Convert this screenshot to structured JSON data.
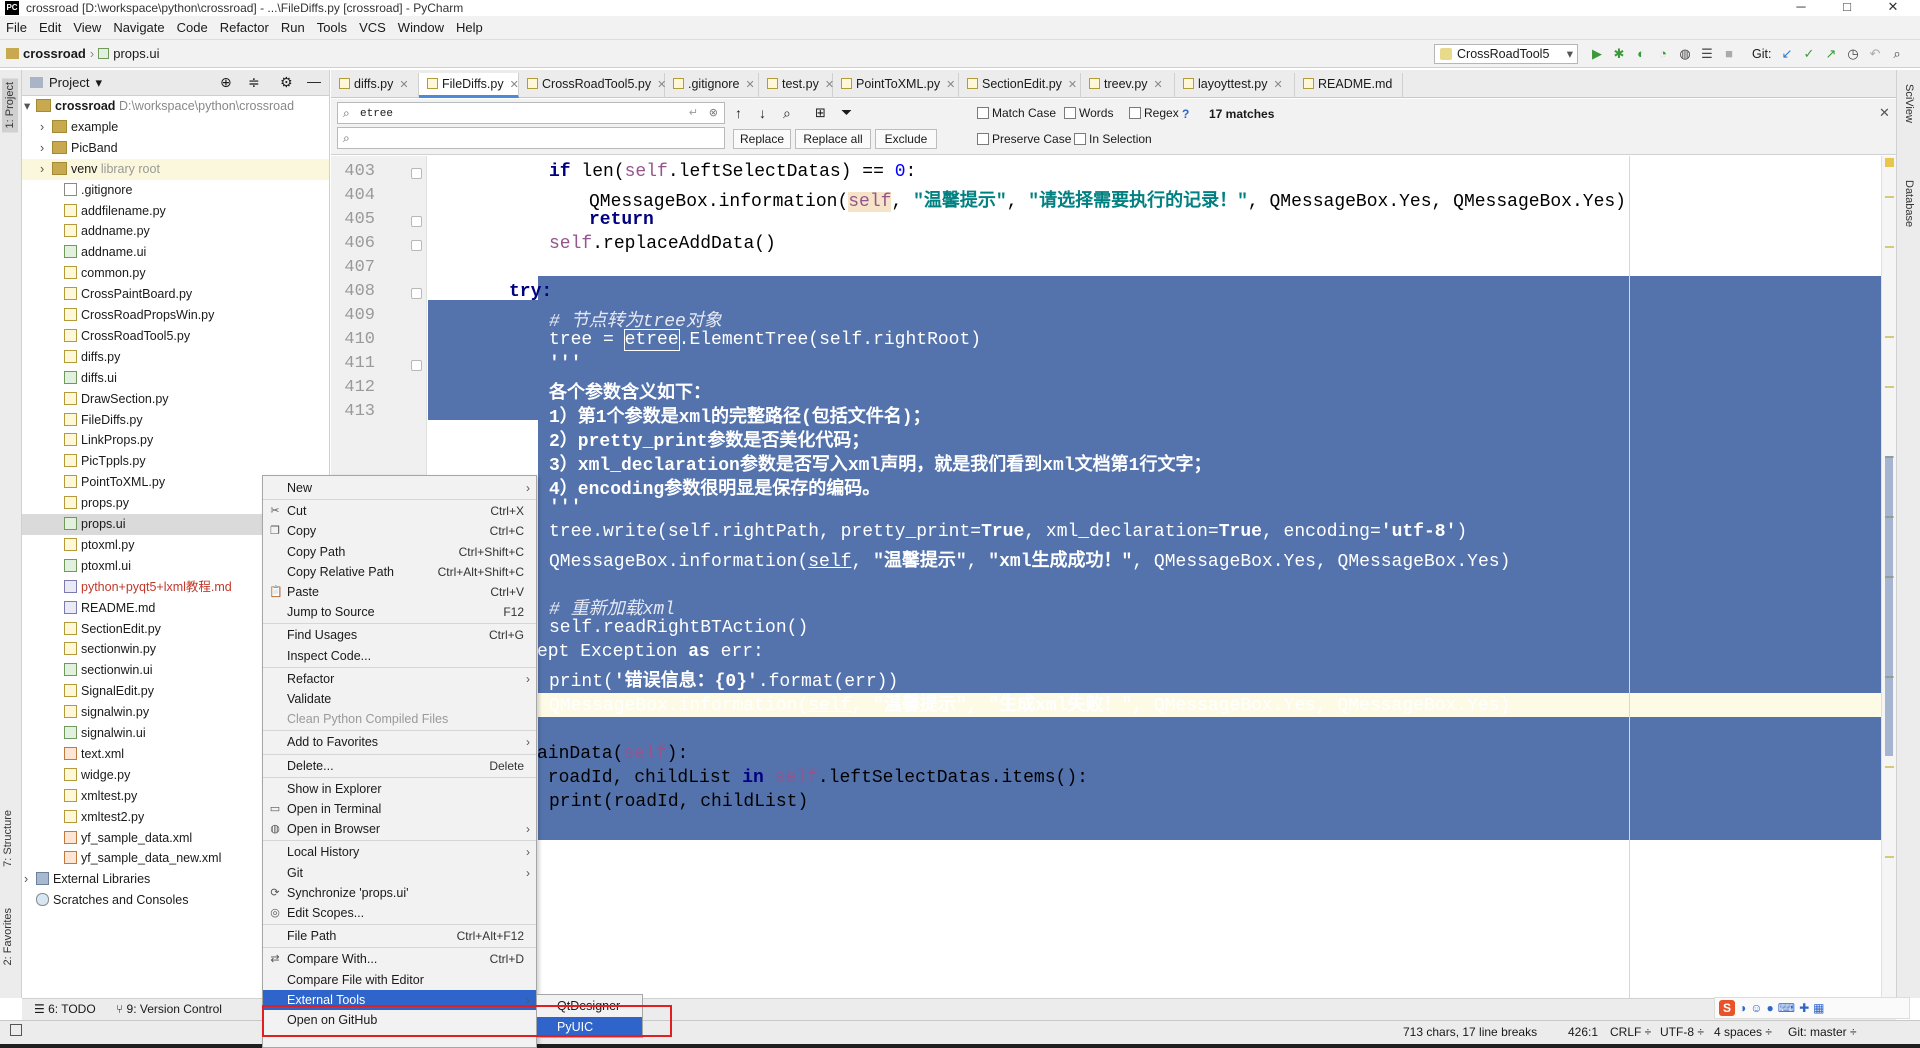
{
  "window": {
    "title": "crossroad [D:\\workspace\\python\\crossroad] - ...\\FileDiffs.py [crossroad] - PyCharm",
    "app_icon": "pycharm-icon",
    "minimize": "─",
    "maximize": "□",
    "close": "✕"
  },
  "menubar": [
    "File",
    "Edit",
    "View",
    "Navigate",
    "Code",
    "Refactor",
    "Run",
    "Tools",
    "VCS",
    "Window",
    "Help"
  ],
  "navbar": {
    "project": "crossroad",
    "file": "props.ui",
    "run_config": "CrossRoadTool5",
    "git_label": "Git:"
  },
  "project_panel": {
    "title": "Project",
    "root_name": "crossroad",
    "root_path": "D:\\workspace\\python\\crossroad",
    "items": [
      {
        "name": "example",
        "kind": "folder"
      },
      {
        "name": "PicBand",
        "kind": "folder"
      },
      {
        "name": "venv",
        "kind": "folder",
        "note": "library root"
      },
      {
        "name": ".gitignore",
        "kind": "file"
      },
      {
        "name": "addfilename.py",
        "kind": "py"
      },
      {
        "name": "addname.py",
        "kind": "py"
      },
      {
        "name": "addname.ui",
        "kind": "ui"
      },
      {
        "name": "common.py",
        "kind": "py"
      },
      {
        "name": "CrossPaintBoard.py",
        "kind": "py"
      },
      {
        "name": "CrossRoadPropsWin.py",
        "kind": "py"
      },
      {
        "name": "CrossRoadTool5.py",
        "kind": "py"
      },
      {
        "name": "diffs.py",
        "kind": "py"
      },
      {
        "name": "diffs.ui",
        "kind": "ui"
      },
      {
        "name": "DrawSection.py",
        "kind": "py"
      },
      {
        "name": "FileDiffs.py",
        "kind": "py"
      },
      {
        "name": "LinkProps.py",
        "kind": "py"
      },
      {
        "name": "PicTppls.py",
        "kind": "py"
      },
      {
        "name": "PointToXML.py",
        "kind": "py"
      },
      {
        "name": "props.py",
        "kind": "py"
      },
      {
        "name": "props.ui",
        "kind": "ui"
      },
      {
        "name": "ptoxml.py",
        "kind": "py"
      },
      {
        "name": "ptoxml.ui",
        "kind": "ui"
      },
      {
        "name": "python+pyqt5+lxml教程.md",
        "kind": "md"
      },
      {
        "name": "README.md",
        "kind": "md"
      },
      {
        "name": "SectionEdit.py",
        "kind": "py"
      },
      {
        "name": "sectionwin.py",
        "kind": "py"
      },
      {
        "name": "sectionwin.ui",
        "kind": "ui"
      },
      {
        "name": "SignalEdit.py",
        "kind": "py"
      },
      {
        "name": "signalwin.py",
        "kind": "py"
      },
      {
        "name": "signalwin.ui",
        "kind": "ui"
      },
      {
        "name": "text.xml",
        "kind": "xml"
      },
      {
        "name": "widge.py",
        "kind": "py"
      },
      {
        "name": "xmltest.py",
        "kind": "py"
      },
      {
        "name": "xmltest2.py",
        "kind": "py"
      },
      {
        "name": "yf_sample_data.xml",
        "kind": "xml"
      },
      {
        "name": "yf_sample_data_new.xml",
        "kind": "xml"
      }
    ],
    "external_libraries": "External Libraries",
    "scratches": "Scratches and Consoles"
  },
  "tabs": [
    "diffs.py",
    "FileDiffs.py",
    "CrossRoadTool5.py",
    ".gitignore",
    "test.py",
    "PointToXML.py",
    "SectionEdit.py",
    "treev.py",
    "layoyttest.py",
    "README.md"
  ],
  "findbar": {
    "query": "etree",
    "replace_btn": "Replace",
    "replace_all_btn": "Replace all",
    "exclude_btn": "Exclude",
    "match_case": "Match Case",
    "words": "Words",
    "regex": "Regex",
    "regex_help": "?",
    "matches": "17 matches",
    "preserve_case": "Preserve Case",
    "in_selection": "In Selection"
  },
  "editor": {
    "line_numbers": [
      "403",
      "404",
      "405",
      "406",
      "407",
      "408",
      "409",
      "410",
      "411",
      "412",
      "413"
    ],
    "code": {
      "l403_a": "if ",
      "l403_b": "len",
      "l403_c": "(",
      "l403_d": "self",
      "l403_e": ".leftSelectDatas) == ",
      "l403_f": "0",
      "l403_g": ":",
      "l404_a": "QMessageBox.information(",
      "l404_b": "self",
      "l404_c": ", ",
      "l404_d": "\"温馨提示\"",
      "l404_e": ", ",
      "l404_f": "\"请选择需要执行的记录！\"",
      "l404_g": ", QMessageBox.Yes, QMessageBox.Yes)",
      "l405": "return",
      "l406_a": "self",
      "l406_b": ".replaceAddData()",
      "l408": "try:",
      "l409": "# 节点转为tree对象",
      "l410_a": "tree = ",
      "l410_b": "etree",
      "l410_c": ".ElementTree(self.rightRoot)",
      "l411": "'''",
      "l412": "各个参数含义如下：",
      "l413": "1）第1个参数是xml的完整路径(包括文件名)；",
      "l414": "2）pretty_print参数是否美化代码；",
      "l415": "3）xml_declaration参数是否写入xml声明，就是我们看到xml文档第1行文字；",
      "l416": "4）encoding参数很明显是保存的编码。",
      "l417": "'''",
      "l418_a": "tree.write(self.rightPath, pretty_print=",
      "l418_b": "True",
      "l418_c": ", xml_declaration=",
      "l418_d": "True",
      "l418_e": ", encoding=",
      "l418_f": "'utf-8'",
      "l418_g": ")",
      "l419_a": "QMessageBox.information(",
      "l419_b": "self",
      "l419_c": ", ",
      "l419_d": "\"温馨提示\"",
      "l419_e": ", ",
      "l419_f": "\"xml生成成功！\"",
      "l419_g": ", QMessageBox.Yes, QMessageBox.Yes)",
      "l421": "# 重新加载xml",
      "l422": "self.readRightBTAction()",
      "l423_a": "ept Exception ",
      "l423_b": "as",
      "l423_c": " err:",
      "l424_a": "print(",
      "l424_b": "'错误信息：{0}'",
      "l424_c": ".format(err))",
      "l425_a": "QMessageBox.information(",
      "l425_b": "self",
      "l425_c": ", ",
      "l425_d": "\"温馨提示\"",
      "l425_e": ", ",
      "l425_f": "\"生成xml失败！\"",
      "l425_g": ", QMessageBox.Yes, QMessageBox.Yes)",
      "l427_a": "ainData(",
      "l427_b": "self",
      "l427_c": "):",
      "l428_a": " roadId, childList ",
      "l428_b": "in",
      "l428_c": " ",
      "l428_d": "self",
      "l428_e": ".leftSelectDatas.items():",
      "l429": "print(roadId, childList)"
    }
  },
  "context_menu": [
    {
      "label": "New",
      "submenu": true
    },
    {
      "sep": true
    },
    {
      "label": "Cut",
      "shortcut": "Ctrl+X",
      "icon": "scissors-icon"
    },
    {
      "label": "Copy",
      "shortcut": "Ctrl+C",
      "icon": "copy-icon"
    },
    {
      "label": "Copy Path",
      "shortcut": "Ctrl+Shift+C"
    },
    {
      "label": "Copy Relative Path",
      "shortcut": "Ctrl+Alt+Shift+C"
    },
    {
      "label": "Paste",
      "shortcut": "Ctrl+V",
      "icon": "paste-icon"
    },
    {
      "label": "Jump to Source",
      "shortcut": "F12"
    },
    {
      "sep": true
    },
    {
      "label": "Find Usages",
      "shortcut": "Ctrl+G"
    },
    {
      "label": "Inspect Code..."
    },
    {
      "sep": true
    },
    {
      "label": "Refactor",
      "submenu": true
    },
    {
      "label": "Validate"
    },
    {
      "label": "Clean Python Compiled Files",
      "disabled": true
    },
    {
      "sep": true
    },
    {
      "label": "Add to Favorites",
      "submenu": true
    },
    {
      "sep": true
    },
    {
      "label": "Delete...",
      "shortcut": "Delete"
    },
    {
      "sep": true
    },
    {
      "label": "Show in Explorer"
    },
    {
      "label": "Open in Terminal",
      "icon": "terminal-icon"
    },
    {
      "label": "Open in Browser",
      "submenu": true,
      "icon": "globe-icon"
    },
    {
      "sep": true
    },
    {
      "label": "Local History",
      "submenu": true
    },
    {
      "label": "Git",
      "submenu": true
    },
    {
      "label": "Synchronize 'props.ui'",
      "icon": "sync-icon"
    },
    {
      "label": "Edit Scopes...",
      "icon": "scope-icon"
    },
    {
      "sep": true
    },
    {
      "label": "File Path",
      "shortcut": "Ctrl+Alt+F12"
    },
    {
      "sep": true
    },
    {
      "label": "Compare With...",
      "shortcut": "Ctrl+D",
      "icon": "compare-icon"
    },
    {
      "label": "Compare File with Editor"
    },
    {
      "label": "External Tools",
      "submenu": true,
      "highlighted": true
    },
    {
      "label": "Open on GitHub"
    }
  ],
  "submenu": [
    "QtDesigner",
    "PyUIC"
  ],
  "bottom_tabs": [
    "6: TODO",
    "9: Version Control"
  ],
  "left_vertical_tabs": [
    "1: Project",
    "7: Structure",
    "2: Favorites"
  ],
  "right_vertical_tabs": [
    "SciView",
    "Database"
  ],
  "status": {
    "chars": "713 chars, 17 line breaks",
    "pos": "426:1",
    "crlf": "CRLF ÷",
    "enc": "UTF-8 ÷",
    "indent": "4 spaces ÷",
    "git": "Git: master ÷"
  },
  "colors": {
    "selection": "#5473ad",
    "highlight": "#2f65ca",
    "red_box": "#e02020"
  }
}
